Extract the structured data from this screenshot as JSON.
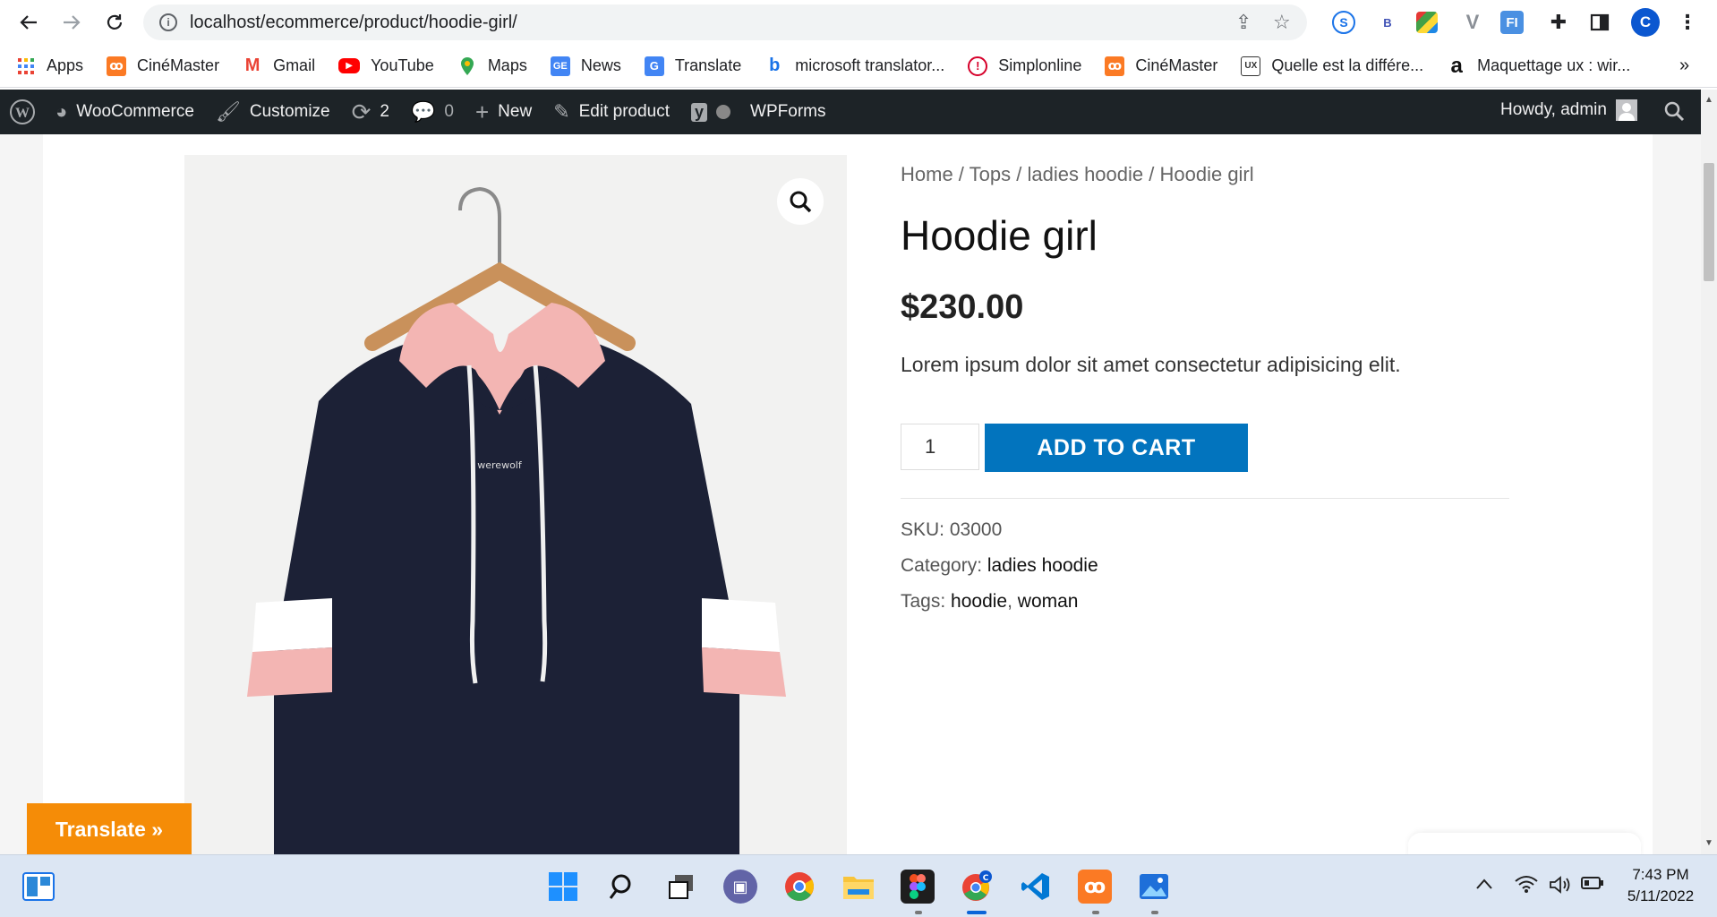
{
  "browser": {
    "url": "localhost/ecommerce/product/hoodie-girl/",
    "profile_initial": "C"
  },
  "bookmarks": [
    {
      "label": "Apps",
      "icon": "apps-grid-icon"
    },
    {
      "label": "CinéMaster",
      "icon": "xampp-icon"
    },
    {
      "label": "Gmail",
      "icon": "gmail-icon"
    },
    {
      "label": "YouTube",
      "icon": "youtube-icon"
    },
    {
      "label": "Maps",
      "icon": "maps-icon"
    },
    {
      "label": "News",
      "icon": "news-icon"
    },
    {
      "label": "Translate",
      "icon": "translate-icon"
    },
    {
      "label": "microsoft translator...",
      "icon": "bing-icon"
    },
    {
      "label": "Simplonline",
      "icon": "simplon-icon"
    },
    {
      "label": "CinéMaster",
      "icon": "xampp-icon"
    },
    {
      "label": "Quelle est la différe...",
      "icon": "blog-ux-icon"
    },
    {
      "label": "Maquettage ux : wir...",
      "icon": "amazon-icon"
    }
  ],
  "bookmarks_more": "»",
  "adminbar": {
    "woocommerce": "WooCommerce",
    "customize": "Customize",
    "updates": "2",
    "comments": "0",
    "new": "New",
    "edit_product": "Edit product",
    "wpforms": "WPForms",
    "howdy": "Howdy, admin"
  },
  "breadcrumb": {
    "home": "Home",
    "sep": " / ",
    "tops": "Tops",
    "category": "ladies hoodie",
    "current": "Hoodie girl"
  },
  "product": {
    "title": "Hoodie girl",
    "price": "$230.00",
    "description": "Lorem ipsum dolor sit amet consectetur adipisicing elit.",
    "quantity": "1",
    "add_to_cart": "ADD TO CART",
    "sku_label": "SKU:",
    "sku": "03000",
    "category_label": "Category:",
    "category": "ladies hoodie",
    "tags_label": "Tags:",
    "tag1": "hoodie",
    "tag2": "woman",
    "print_text": "werewolf"
  },
  "translate_widget": "Translate »",
  "taskbar": {
    "time": "7:43 PM",
    "date": "5/11/2022"
  },
  "colors": {
    "accent": "#0274be",
    "translate": "#f58c07",
    "adminbar": "#1d2327",
    "hoodie_navy": "#1c2136",
    "hoodie_pink": "#f3b5b3"
  }
}
